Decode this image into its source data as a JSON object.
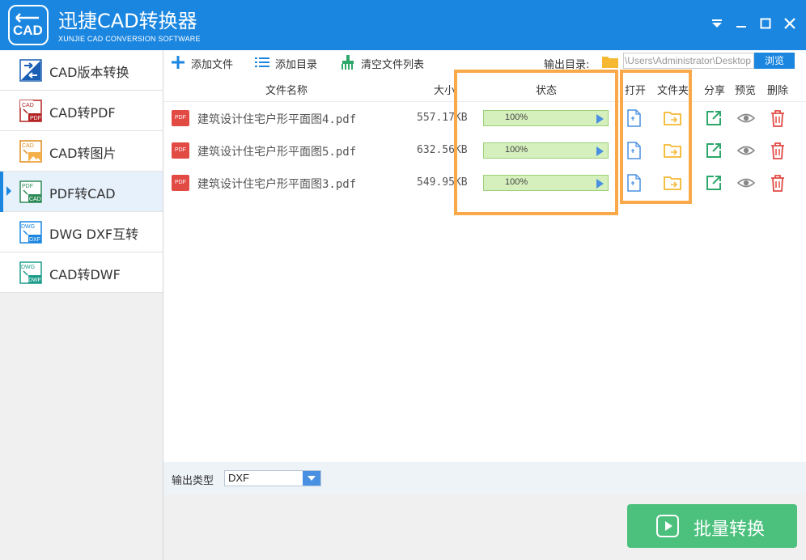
{
  "app": {
    "title": "迅捷CAD转换器",
    "subtitle": "XUNJIE CAD CONVERSION SOFTWARE",
    "logo_text": "CAD"
  },
  "window_controls": {
    "menu_icon": "dropdown-menu-icon",
    "minimize_icon": "minimize-icon",
    "maximize_icon": "maximize-icon",
    "close_icon": "close-icon"
  },
  "sidebar": {
    "items": [
      {
        "label": "CAD版本转换",
        "icon": "cad-version-icon",
        "active": false
      },
      {
        "label": "CAD转PDF",
        "icon": "cad-to-pdf-icon",
        "active": false
      },
      {
        "label": "CAD转图片",
        "icon": "cad-to-image-icon",
        "active": false
      },
      {
        "label": "PDF转CAD",
        "icon": "pdf-to-cad-icon",
        "active": true
      },
      {
        "label": "DWG DXF互转",
        "icon": "dwg-dxf-icon",
        "active": false
      },
      {
        "label": "CAD转DWF",
        "icon": "cad-to-dwf-icon",
        "active": false
      }
    ]
  },
  "toolbar": {
    "add_file": "添加文件",
    "add_dir": "添加目录",
    "clear_list": "清空文件列表",
    "output_dir_label": "输出目录:",
    "output_path": "C:\\Users\\Administrator\\Desktop",
    "browse": "浏览"
  },
  "table": {
    "headers": {
      "name": "文件名称",
      "size": "大小",
      "status": "状态",
      "open": "打开",
      "folder": "文件夹",
      "share": "分享",
      "preview": "预览",
      "delete": "删除"
    },
    "rows": [
      {
        "badge": "PDF",
        "name": "建筑设计住宅户形平面图4.pdf",
        "size": "557.17KB",
        "progress": "100%",
        "progress_fraction": 1.0
      },
      {
        "badge": "PDF",
        "name": "建筑设计住宅户形平面图5.pdf",
        "size": "632.56KB",
        "progress": "100%",
        "progress_fraction": 1.0
      },
      {
        "badge": "PDF",
        "name": "建筑设计住宅户形平面图3.pdf",
        "size": "549.95KB",
        "progress": "100%",
        "progress_fraction": 1.0
      }
    ]
  },
  "bottom": {
    "output_type_label": "输出类型",
    "output_type_value": "DXF",
    "convert_button": "批量转换"
  },
  "colors": {
    "title_bar": "#1a86e0",
    "highlight": "#f9a94a",
    "convert_button": "#4cc07d",
    "progress_fill": "#dcf3c9",
    "pdf_badge": "#e24a44"
  }
}
